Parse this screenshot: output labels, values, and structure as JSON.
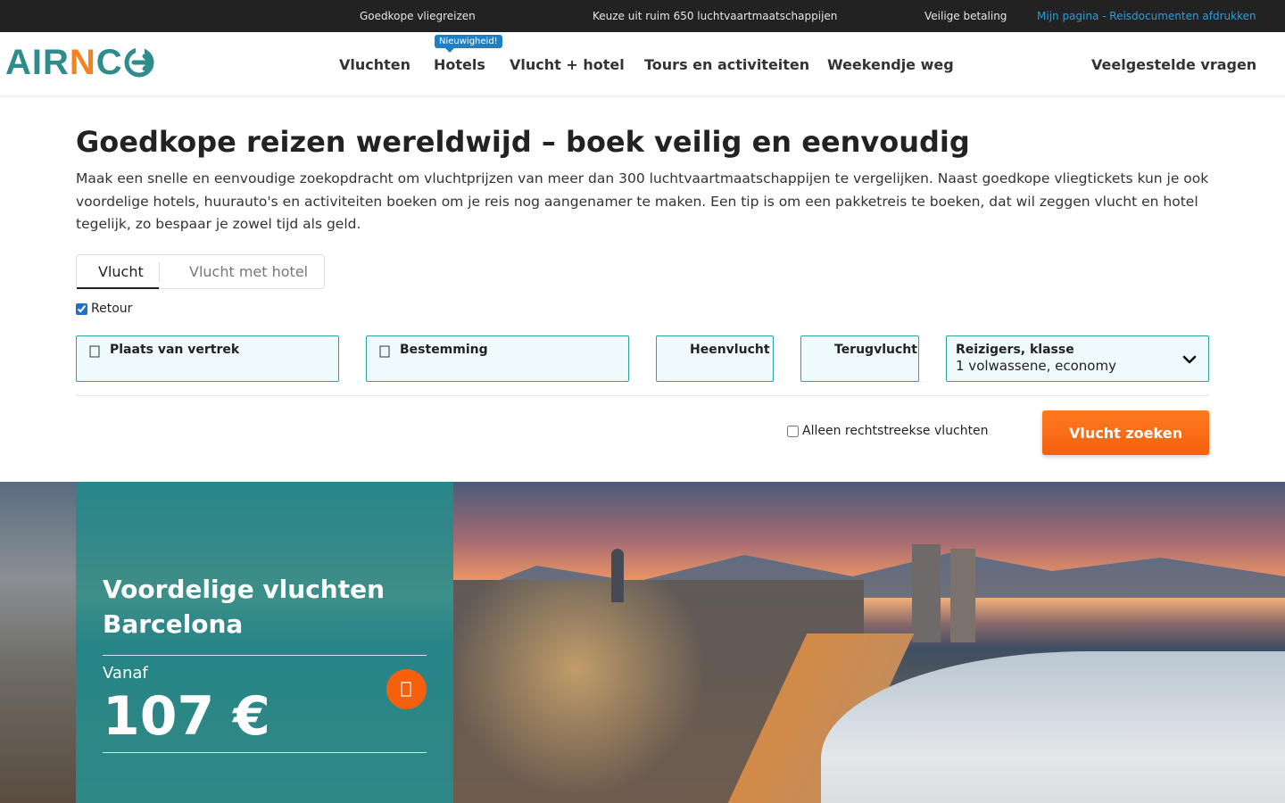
{
  "topbar": {
    "item1": "Goedkope vliegreizen",
    "item2": "Keuze uit ruim 650 luchtvaartmaatschappijen",
    "item3": "Veilige betaling",
    "link": "Mijn pagina - Reisdocumenten afdrukken"
  },
  "logo": {
    "part1": "AIR",
    "part2": "N",
    "part3": "C"
  },
  "nav": {
    "vluchten": "Vluchten",
    "hotels": "Hotels",
    "hotels_badge": "Nieuwigheid!",
    "vlucht_hotel": "Vlucht + hotel",
    "tours": "Tours en activiteiten",
    "weekend": "Weekendje weg",
    "faq": "Veelgestelde vragen"
  },
  "main": {
    "title": "Goedkope reizen wereldwijd – boek veilig en eenvoudig",
    "intro": "Maak een snelle en eenvoudige zoekopdracht om vluchtprijzen van meer dan 300 luchtvaartmaatschappijen te vergelijken. Naast goedkope vliegtickets kun je ook voordelige hotels, huurauto's en activiteiten boeken om je reis nog aangenamer te maken. Een tip is om een pakketreis te boeken, dat wil zeggen vlucht en hotel tegelijk, zo bespaar je zowel tijd als geld."
  },
  "search": {
    "tabs": {
      "flight": "Vlucht",
      "flight_hotel": "Vlucht met hotel"
    },
    "retour_label": "Retour",
    "retour_checked": true,
    "fields": {
      "vertrek": "Plaats van vertrek",
      "bestemming": "Bestemming",
      "heenvlucht": "Heenvlucht",
      "terugvlucht": "Terugvlucht",
      "reizigers_label": "Reizigers, klasse",
      "reizigers_value": "1 volwassene, economy"
    },
    "direct_label": "Alleen rechtstreekse vluchten",
    "direct_checked": false,
    "button": "Vlucht zoeken"
  },
  "promo": {
    "title": "Voordelige vluchten Barcelona",
    "from_label": "Vanaf",
    "price": "107 €"
  },
  "colors": {
    "brand_teal": "#2f8c8c",
    "brand_orange": "#f5821f",
    "cta_orange": "#f5600e",
    "topbar_bg": "#222222",
    "link_blue": "#2a9fd8",
    "field_border": "#2ca3a3"
  }
}
